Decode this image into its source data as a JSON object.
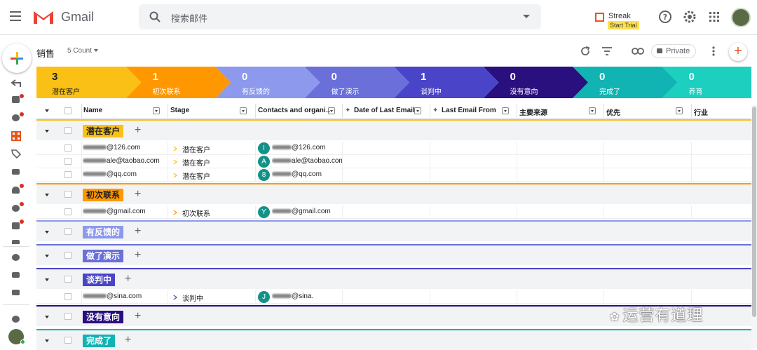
{
  "app": {
    "name": "Gmail"
  },
  "search": {
    "placeholder": "搜索邮件"
  },
  "streak": {
    "name": "Streak",
    "trial": "Start Trial"
  },
  "pipeline": {
    "name": "销售",
    "count": "5 Count",
    "private_label": "Private"
  },
  "colors": {
    "accent": "#e8541e",
    "streak_yellow": "#ffe14d",
    "teal_avatar": "#149288"
  },
  "stages": [
    {
      "count": "3",
      "name": "潜在客户",
      "color": "#fbc016",
      "dark": true
    },
    {
      "count": "1",
      "name": "初次联系",
      "color": "#ff9800"
    },
    {
      "count": "0",
      "name": "有反馈的",
      "color": "#8c99ec"
    },
    {
      "count": "0",
      "name": "做了演示",
      "color": "#6a6fd9"
    },
    {
      "count": "1",
      "name": "谈判中",
      "color": "#4a44c8"
    },
    {
      "count": "0",
      "name": "没有意向",
      "color": "#2a0f7e"
    },
    {
      "count": "0",
      "name": "完成了",
      "color": "#11b3b3"
    },
    {
      "count": "0",
      "name": "养育",
      "color": "#1ccfbf"
    }
  ],
  "columns": [
    "Name",
    "Stage",
    "Contacts and organi…ition",
    "Date of Last Email",
    "Last Email From",
    "主要来源",
    "优先",
    "行业"
  ],
  "groups": [
    {
      "name": "潜在客户",
      "color": "#fbc016",
      "text_color": "#202124",
      "rows": [
        {
          "name": "@126.com",
          "stage": "潜在客户",
          "contact_initial": "I",
          "contact": "@126.com"
        },
        {
          "name": "ale@taobao.com",
          "stage": "潜在客户",
          "contact_initial": "A",
          "contact": "ale@taobao.com"
        },
        {
          "name": "@qq.com",
          "stage": "潜在客户",
          "contact_initial": "8",
          "contact": "@qq.com"
        }
      ]
    },
    {
      "name": "初次联系",
      "color": "#ff9800",
      "text_color": "#202124",
      "rows": [
        {
          "name": "@gmail.com",
          "stage": "初次联系",
          "contact_initial": "Y",
          "contact": "@gmail.com"
        }
      ]
    },
    {
      "name": "有反馈的",
      "color": "#8c99ec",
      "text_color": "#fff",
      "rows": []
    },
    {
      "name": "做了演示",
      "color": "#6a6fd9",
      "text_color": "#fff",
      "rows": []
    },
    {
      "name": "谈判中",
      "color": "#4a44c8",
      "text_color": "#fff",
      "rows": [
        {
          "name": "@sina.com",
          "stage": "谈判中",
          "contact_initial": "J",
          "contact": "@sina."
        }
      ]
    },
    {
      "name": "没有意向",
      "color": "#2a0f7e",
      "text_color": "#fff",
      "rows": []
    },
    {
      "name": "完成了",
      "color": "#11b3b3",
      "text_color": "#fff",
      "rows": []
    }
  ],
  "watermark": "运营有道理"
}
